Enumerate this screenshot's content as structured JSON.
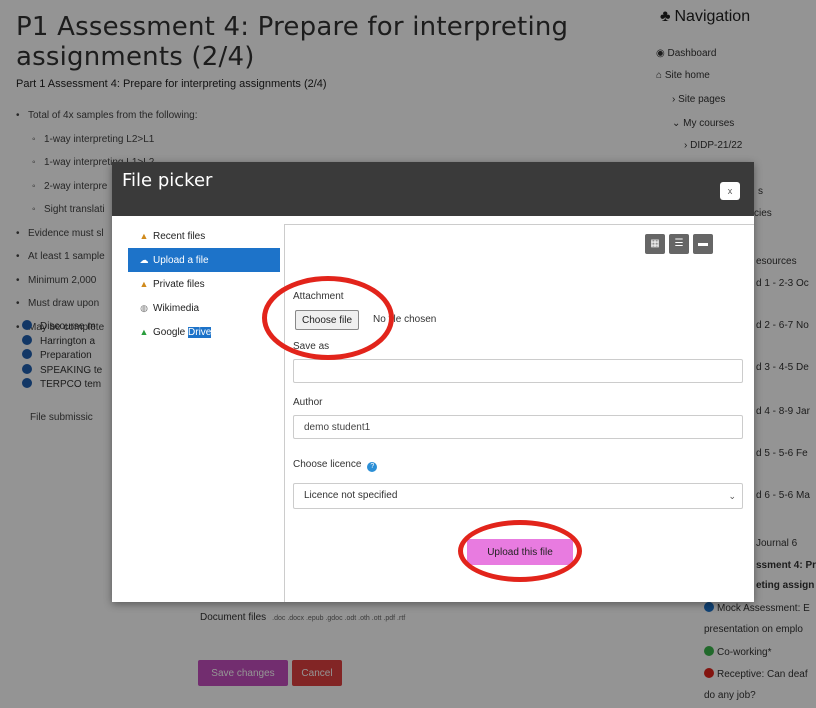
{
  "page": {
    "title": "P1 Assessment 4: Prepare for interpreting assignments (2/4)",
    "subtitle": "Part 1 Assessment 4: Prepare for interpreting assignments (2/4)",
    "bullets": [
      {
        "text": "Total of 4x samples from the following:",
        "level": 0
      },
      {
        "text": "1-way interpreting L2>L1",
        "level": 1
      },
      {
        "text": "1-way interpreting L1>L2",
        "level": 1
      },
      {
        "text": "2-way interpre",
        "level": 1
      },
      {
        "text": "Sight translati",
        "level": 1
      },
      {
        "text": "Evidence must sl",
        "level": 0
      },
      {
        "text": "At least 1 sample",
        "level": 0
      },
      {
        "text": "Minimum 2,000",
        "level": 0
      },
      {
        "text": "Must draw upon",
        "level": 0
      },
      {
        "text": "May be complete",
        "level": 0
      }
    ],
    "files": [
      "Discourse m",
      "Harrington a",
      "Preparation",
      "SPEAKING te",
      "TERPCO tem"
    ],
    "file_submission_label": "File submissic",
    "document_files_label": "Document files",
    "document_files_ext": ".doc .docx .epub .gdoc .odt .oth .ott .pdf .rtf",
    "save_label": "Save changes",
    "cancel_label": "Cancel"
  },
  "navigation": {
    "heading": "Navigation",
    "items": [
      {
        "text": "Dashboard",
        "icon": "dashboard-icon"
      },
      {
        "text": "Site home",
        "icon": "home-icon"
      },
      {
        "text": "Site pages",
        "icon": "chevron-right-icon"
      },
      {
        "text": "My courses",
        "icon": "chevron-down-icon"
      },
      {
        "text": "DIDP-21/22",
        "icon": "chevron-right-icon"
      },
      {
        "text": "s"
      },
      {
        "text": "cies"
      },
      {
        "text": "esources"
      },
      {
        "text": "d 1 - 2-3 Oc"
      },
      {
        "text": "d 2 - 6-7 No"
      },
      {
        "text": "d 3 - 4-5 De"
      },
      {
        "text": "d 4 - 8-9 Jar"
      },
      {
        "text": "d 5 - 5-6 Fe"
      },
      {
        "text": "d 6 - 5-6 Ma"
      },
      {
        "text": "Journal 6"
      },
      {
        "text": "ssment 4: Pr"
      },
      {
        "text": "eting assign"
      },
      {
        "text": "Mock Assessment: E"
      },
      {
        "text": "presentation on emplo"
      },
      {
        "text": "Co-working*"
      },
      {
        "text": "Receptive: Can deaf"
      },
      {
        "text": "do any job?"
      }
    ]
  },
  "file_picker": {
    "title": "File picker",
    "close_label": "x",
    "repositories": [
      {
        "text": "Recent files",
        "icon": "recent-files-icon"
      },
      {
        "text": "Upload a file",
        "icon": "upload-icon"
      },
      {
        "text": "Private files",
        "icon": "private-files-icon"
      },
      {
        "text": "Wikimedia",
        "icon": "wikimedia-icon"
      },
      {
        "text": "Google ",
        "highlight": "Drive",
        "icon": "google-drive-icon"
      }
    ],
    "attachment_label": "Attachment",
    "choose_file_label": "Choose file",
    "no_file_text": "No file chosen",
    "save_as_label": "Save as",
    "save_as_value": "",
    "author_label": "Author",
    "author_value": "demo student1",
    "licence_label": "Choose licence",
    "licence_value": "Licence not specified",
    "upload_label": "Upload this file"
  },
  "colors": {
    "accent_blue": "#1d73c9",
    "upload_button": "#e87be0",
    "annotation_ring": "#e2241b"
  }
}
